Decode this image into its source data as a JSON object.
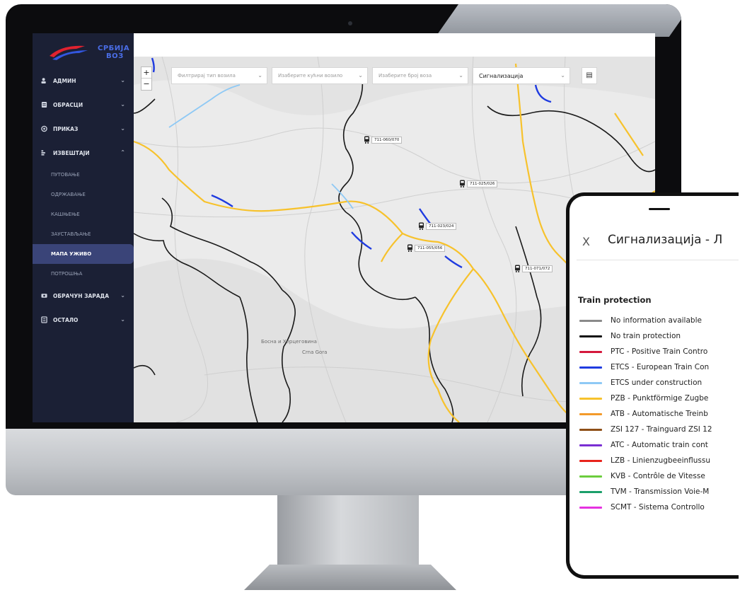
{
  "brand": {
    "line1": "СРБИЈА",
    "line2": "ВОЗ"
  },
  "sidebar": {
    "items": [
      {
        "label": "АДМИН",
        "icon": "admin-icon",
        "chevron": "⌄"
      },
      {
        "label": "ОБРАСЦИ",
        "icon": "forms-icon",
        "chevron": "⌄"
      },
      {
        "label": "ПРИКАЗ",
        "icon": "view-icon",
        "chevron": "⌄"
      },
      {
        "label": "ИЗВЕШТАЈИ",
        "icon": "reports-icon",
        "chevron": "⌃"
      }
    ],
    "subitems": [
      {
        "label": "ПУТОВАЊЕ"
      },
      {
        "label": "ОДРЖАВАЊЕ"
      },
      {
        "label": "КАШЊЕЊЕ"
      },
      {
        "label": "ЗАУСТАВЉАЊЕ"
      },
      {
        "label": "МАПА УЖИВО",
        "active": true
      },
      {
        "label": "ПОТРОШЊА"
      }
    ],
    "items_after": [
      {
        "label": "ОБРАЧУН ЗАРАДА",
        "icon": "payroll-icon",
        "chevron": "⌄"
      },
      {
        "label": "ОСТАЛО",
        "icon": "other-icon",
        "chevron": "⌄"
      }
    ]
  },
  "map": {
    "zoom_in": "+",
    "zoom_out": "−",
    "filters": [
      {
        "placeholder": "Филтрирај тип возила"
      },
      {
        "placeholder": "Изаберите кућни возило"
      },
      {
        "placeholder": "Изаберите број воза"
      }
    ],
    "layer_select": "Сигнализација",
    "layer_button_icon": "map-layers-icon",
    "trains": [
      "711-060/070",
      "711-025/026",
      "711-023/024",
      "711-055/056",
      "711-071/072"
    ],
    "region_label_1": "Босна и Херцеговина",
    "region_label_2": "Crna Gora"
  },
  "legend_panel": {
    "close": "X",
    "title": "Сигнализација - Л",
    "section": "Train protection",
    "items": [
      {
        "label": "No information available",
        "color": "#8a8a8a"
      },
      {
        "label": "No train protection",
        "color": "#111111"
      },
      {
        "label": "PTC - Positive Train Contro",
        "color": "#d4183c"
      },
      {
        "label": "ETCS - European Train Con",
        "color": "#1f3be0"
      },
      {
        "label": "ETCS under construction",
        "color": "#8ec9f5"
      },
      {
        "label": "PZB - Punktförmige Zugbe",
        "color": "#f7c22c"
      },
      {
        "label": "ATB - Automatische Treinb",
        "color": "#f39a2a"
      },
      {
        "label": "ZSI 127 - Trainguard ZSI 12",
        "color": "#8e4f17"
      },
      {
        "label": "ATC - Automatic train cont",
        "color": "#7a2fd3"
      },
      {
        "label": "LZB - Linienzugbeeinflussu",
        "color": "#e8231c"
      },
      {
        "label": "KVB - Contrôle de Vitesse",
        "color": "#6ccd3d"
      },
      {
        "label": "TVM - Transmission Voie-M",
        "color": "#1b9f6a"
      },
      {
        "label": "SCMT - Sistema Controllo",
        "color": "#e532e0"
      }
    ]
  }
}
